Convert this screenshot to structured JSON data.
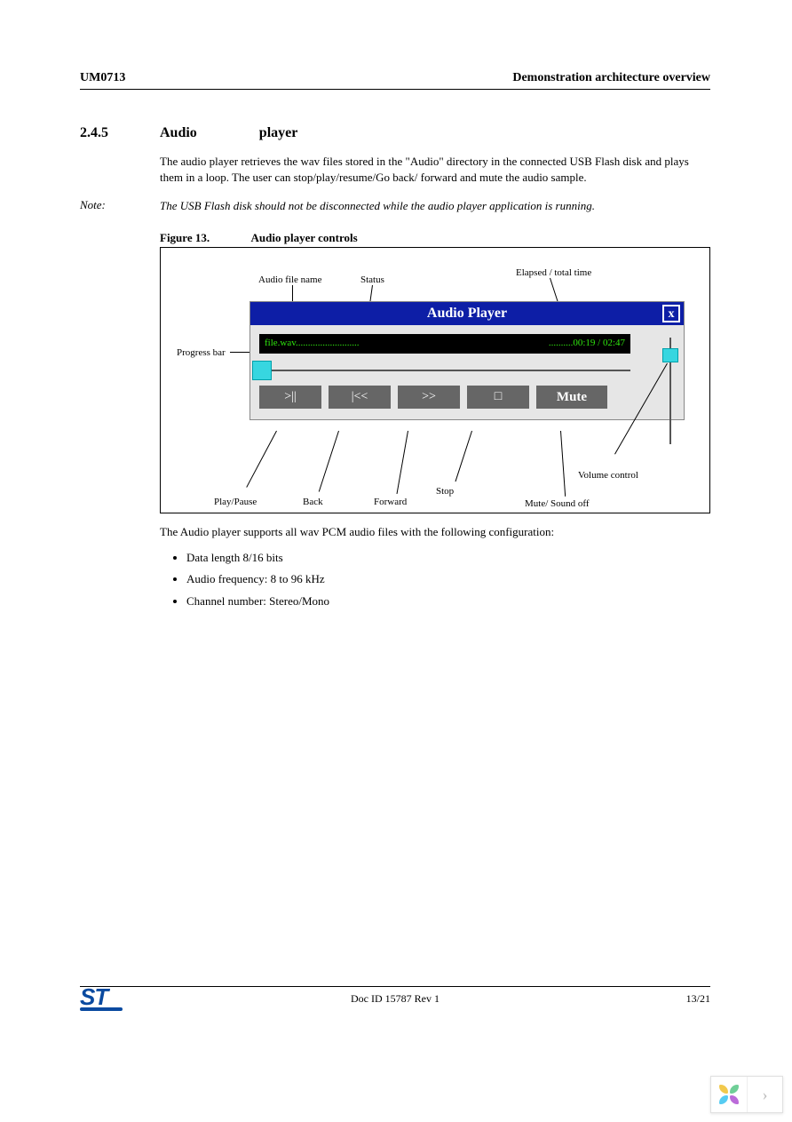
{
  "header": {
    "doc_code": "UM0713",
    "section_title": "Demonstration architecture overview"
  },
  "section": {
    "number": "2.4.5",
    "word1": "Audio",
    "word2": "player"
  },
  "intro": "The audio player retrieves the wav files stored in the \"Audio\" directory in the connected USB Flash disk and plays them in a loop. The user can stop/play/resume/Go back/ forward and mute the audio sample.",
  "note": {
    "label": "Note:",
    "text": "The USB Flash disk should not be disconnected while the audio player application is running."
  },
  "figure": {
    "number": "Figure 13.",
    "caption": "Audio player controls"
  },
  "callouts": {
    "audio_file_name": "Audio file name",
    "status": "Status",
    "elapsed_total": "Elapsed / total time",
    "progress_bar": "Progress bar",
    "play_pause": "Play/Pause",
    "back": "Back",
    "forward": "Forward",
    "stop": "Stop",
    "mute_sound_off": "Mute/ Sound off",
    "volume_control": "Volume control"
  },
  "player": {
    "title": "Audio Player",
    "close": "x",
    "filename": "file.wav..........................",
    "elapsed": "..........00:19 / 02:47",
    "buttons": {
      "play_pause": ">||",
      "back": "|<<",
      "forward": ">>",
      "stop": "□",
      "mute": "Mute"
    }
  },
  "after_figure": "The Audio player supports all wav PCM audio files with the following configuration:",
  "bullets": [
    "Data length 8/16 bits",
    "Audio frequency: 8 to 96 kHz",
    "Channel number: Stereo/Mono"
  ],
  "footer": {
    "logo": "ST",
    "doc_id": "Doc ID 15787 Rev 1",
    "page": "13/21"
  },
  "nav": {
    "chevron": "›"
  }
}
